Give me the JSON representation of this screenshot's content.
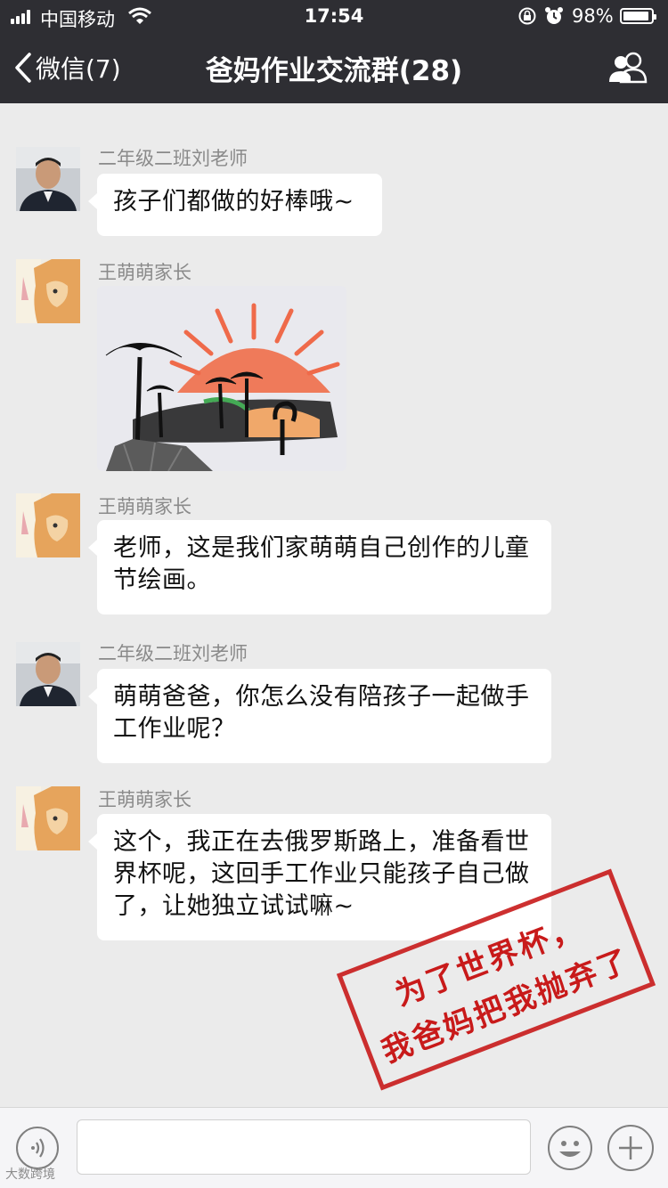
{
  "status_bar": {
    "carrier": "中国移动",
    "time": "17:54",
    "battery_percent": "98%",
    "battery_level": 0.98,
    "icons": [
      "signal-icon",
      "wifi-icon",
      "rotation-lock-icon",
      "alarm-icon",
      "battery-icon"
    ]
  },
  "nav": {
    "back_label": "微信(7)",
    "title": "爸妈作业交流群(28)",
    "back_icon": "chevron-left-icon",
    "members_icon": "group-members-icon"
  },
  "messages": [
    {
      "sender": "二年级二班刘老师",
      "type": "text",
      "text": "孩子们都做的好棒哦~",
      "avatar": "teacher-avatar"
    },
    {
      "sender": "王萌萌家长",
      "type": "image",
      "image": "child-drawing-sunset-palm-trees",
      "avatar": "cat-avatar"
    },
    {
      "sender": "王萌萌家长",
      "type": "text",
      "text": "老师，这是我们家萌萌自己创作的儿童节绘画。",
      "avatar": "cat-avatar"
    },
    {
      "sender": "二年级二班刘老师",
      "type": "text",
      "text": "萌萌爸爸，你怎么没有陪孩子一起做手工作业呢？",
      "avatar": "teacher-avatar"
    },
    {
      "sender": "王萌萌家长",
      "type": "text",
      "text": "这个，我正在去俄罗斯路上，准备看世界杯呢，这回手工作业只能孩子自己做了，让她独立试试嘛~",
      "avatar": "cat-avatar"
    }
  ],
  "stamp": {
    "line1": "为了世界杯，",
    "line2": "我爸妈把我抛弃了",
    "color": "#c81a1a"
  },
  "input_bar": {
    "value": "",
    "icons": [
      "voice-icon",
      "emoji-icon",
      "plus-icon"
    ]
  },
  "watermark": "大数跨境",
  "colors": {
    "header_bg": "#2e2e33",
    "chat_bg": "#ebebeb",
    "bubble_bg": "#ffffff",
    "stamp": "#c81a1a"
  }
}
